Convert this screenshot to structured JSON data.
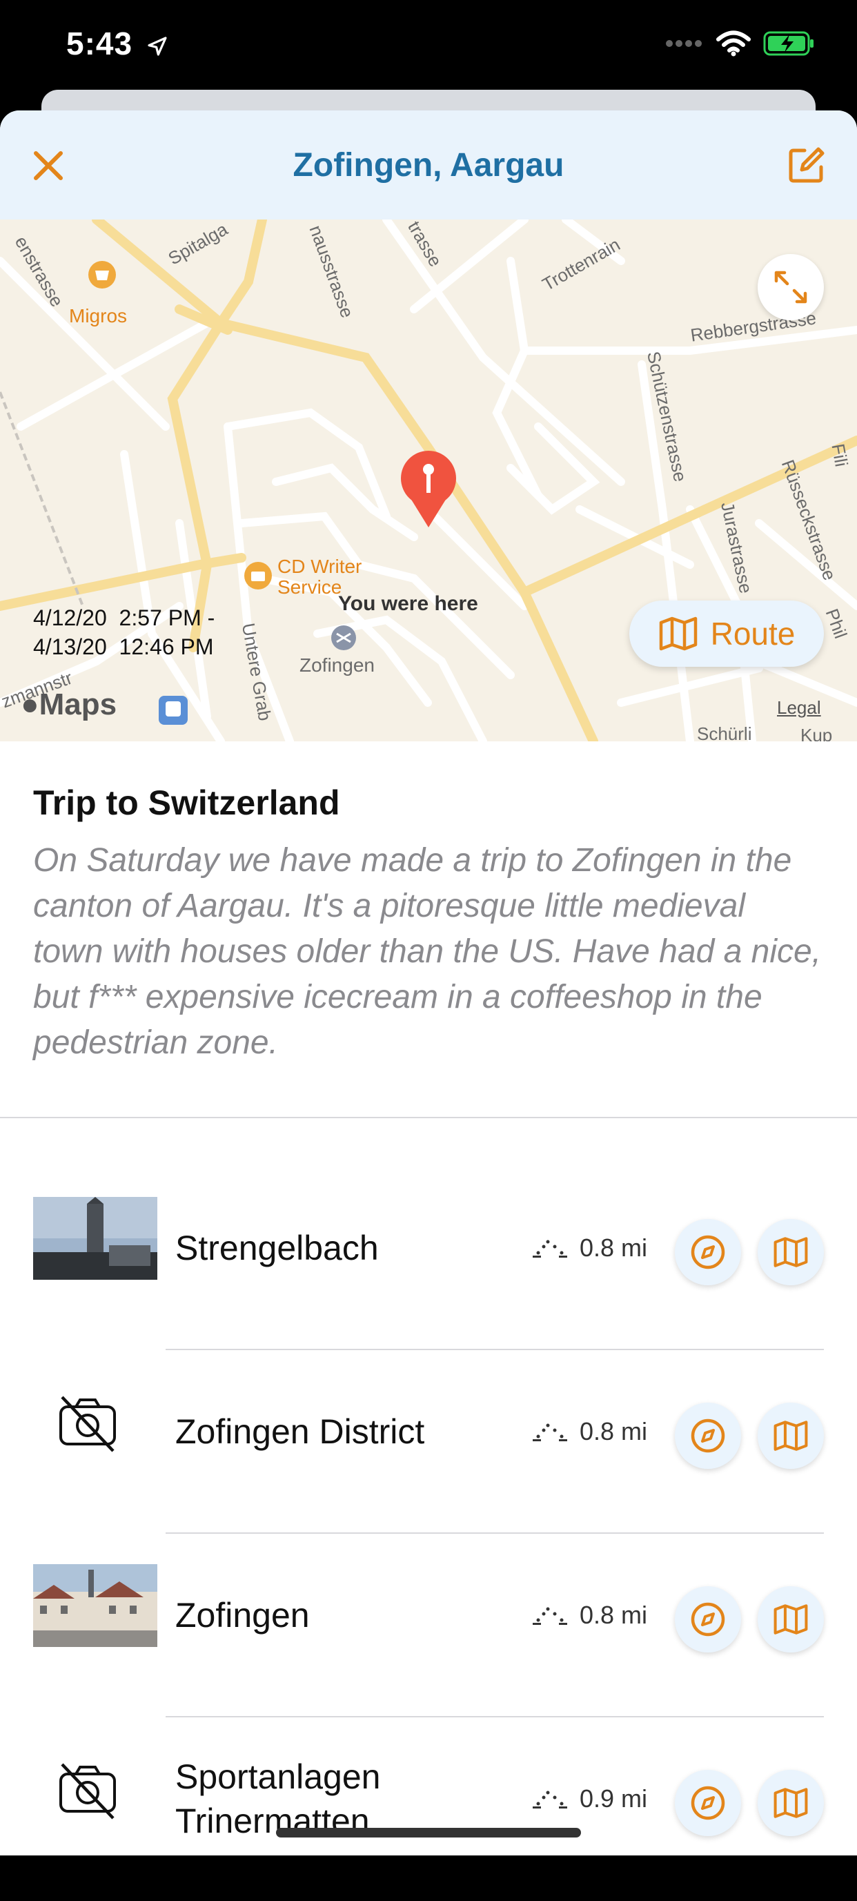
{
  "status_bar": {
    "time": "5:43"
  },
  "nav": {
    "title": "Zofingen, Aargau"
  },
  "map": {
    "pin_label": "You were here",
    "labels": {
      "migros": "Migros",
      "cd_writer": "CD Writer Service",
      "zofingen": "Zofingen",
      "spitalga": "Spitalga",
      "strasse1": "nausstrasse",
      "strasse2": "trasse",
      "trottenrain": "Trottenrain",
      "rebberg": "Rebbergstrasse",
      "schuetzen": "Schützenstrasse",
      "jura": "Jurastrasse",
      "ruesseck": "Rüsseckstrasse",
      "schuerli": "Schürli",
      "ens": "enstrasse",
      "mann": "zmannstr",
      "untere": "Untere Grab",
      "phil": "Phil",
      "kup": "Kup",
      "fili": "Fili"
    },
    "dates_line1": "4/12/20  2:57 PM -",
    "dates_line2": "4/13/20  12:46 PM",
    "route_label": "Route",
    "maps_logo": "Maps",
    "legal": "Legal"
  },
  "trip": {
    "title": "Trip to Switzerland",
    "description": "On Saturday we have made a trip to Zofingen in the canton of Aargau. It's a pitoresque little medieval town with houses older than the US. Have had a nice, but f*** expensive icecream in a coffeeshop in the pedestrian zone."
  },
  "places": [
    {
      "name": "Strengelbach",
      "distance": "0.8 mi",
      "thumb": "church-tower-photo"
    },
    {
      "name": "Zofingen District",
      "distance": "0.8 mi",
      "thumb": "no-photo"
    },
    {
      "name": "Zofingen",
      "distance": "0.8 mi",
      "thumb": "town-square-photo"
    },
    {
      "name": "Sportanlagen Trinermatten",
      "distance": "0.9 mi",
      "thumb": "no-photo"
    }
  ],
  "colors": {
    "accent": "#e3851a",
    "title_blue": "#1f6fa3",
    "nav_bg": "#e9f3fc",
    "pin_red": "#f0533f"
  }
}
